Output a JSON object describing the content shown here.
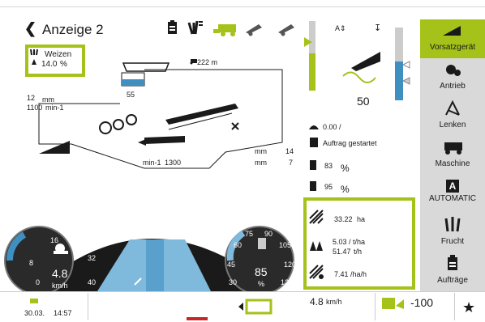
{
  "header": {
    "title": "Anzeige 2"
  },
  "crop_box": {
    "crop": "Weizen",
    "moisture": "14.0",
    "moisture_unit": "%"
  },
  "machine": {
    "speed_label": "222 m",
    "fill_value": "55",
    "conc_mm": "12",
    "conc_mm_unit": "mm",
    "rpm": "1100",
    "rpm_unit": "min-1",
    "rotor_rpm_unit": "min-1",
    "rotor_rpm": "1300",
    "mm_a": "14",
    "mm_b": "7",
    "mm_unit": "mm"
  },
  "gauges": {
    "left": {
      "ticks": [
        "8",
        "16",
        "24",
        "32",
        "40",
        "0"
      ],
      "speed": "4.8",
      "unit": "km/h"
    },
    "right": {
      "ticks": [
        "60",
        "75",
        "90",
        "105",
        "120",
        "135",
        "45",
        "30"
      ],
      "value": "85",
      "unit": "%"
    }
  },
  "right_panel": {
    "header_value": "50",
    "fuel_value": "0.00 /",
    "order_status": "Auftrag gestartet",
    "fuel_pct": "83",
    "adblue_pct": "95",
    "pct_unit": "%",
    "area": "33.22",
    "area_unit": "ha",
    "yield_1": "5.03",
    "yield_1_unit": "/ t/ha",
    "yield_2": "51.47",
    "yield_2_unit": "t/h",
    "rate": "7.41",
    "rate_unit": "/ha/h"
  },
  "sidebar": {
    "items": [
      {
        "label": "Vorsatzgerät",
        "icon": "header-attachment-icon"
      },
      {
        "label": "Antrieb",
        "icon": "drive-icon"
      },
      {
        "label": "Lenken",
        "icon": "steering-icon"
      },
      {
        "label": "Maschine",
        "icon": "machine-icon"
      },
      {
        "label": "AUTOMATIC",
        "icon": "automatic-icon",
        "glyph": "A"
      },
      {
        "label": "Frucht",
        "icon": "crop-icon"
      },
      {
        "label": "Aufträge",
        "icon": "orders-icon"
      }
    ]
  },
  "bottom": {
    "date": "30.03.",
    "time": "14:57",
    "speed": "4.8",
    "speed_unit": "km/h",
    "offset": "-100"
  },
  "colors": {
    "accent": "#a4c21a",
    "blue": "#7fb9dc",
    "dark": "#1a1a1a"
  }
}
